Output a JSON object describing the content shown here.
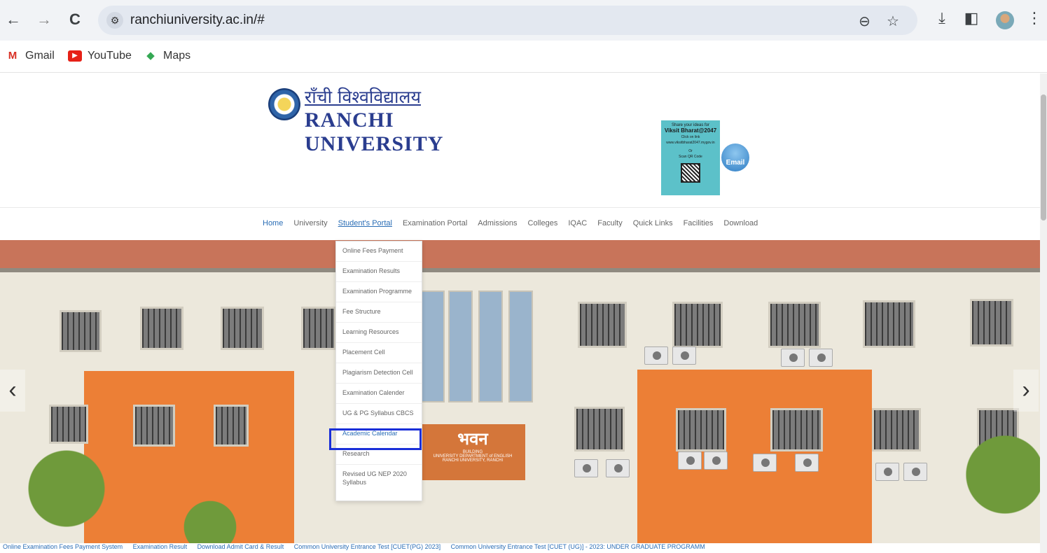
{
  "browser": {
    "url": "ranchiuniversity.ac.in/#",
    "back_icon": "←",
    "forward_icon": "→",
    "reload_icon": "C",
    "site_info_icon": "⚙",
    "zoom_icon": "⊖",
    "star_icon": "☆",
    "download_icon": "⤓",
    "sidepanel_icon": "◧",
    "menu_icon": "⋮"
  },
  "bookmarks": [
    {
      "label": "Gmail",
      "icon": "M"
    },
    {
      "label": "YouTube",
      "icon": "▶"
    },
    {
      "label": "Maps",
      "icon": "◆"
    }
  ],
  "header": {
    "hindi_name": "राँची विश्वविद्यालय",
    "english_name": "RANCHI UNIVERSITY",
    "viksit": {
      "line1": "Share your ideas for",
      "line2": "Viksit Bharat@2047",
      "line3": "Click on link",
      "line4": "www.viksitbharat2047.mygov.in",
      "line5": "Or",
      "line6": "Scan QR Code"
    },
    "email_label": "Email"
  },
  "nav": {
    "items": [
      "Home",
      "University",
      "Student's Portal",
      "Examination Portal",
      "Admissions",
      "Colleges",
      "IQAC",
      "Faculty",
      "Quick Links",
      "Facilities",
      "Download"
    ]
  },
  "dropdown": {
    "items": [
      "Online Fees Payment",
      "Examination Results",
      "Examination Programme",
      "Fee Structure",
      "Learning Resources",
      "Placement Cell",
      "Plagiarism Detection Cell",
      "Examination Calender",
      "UG & PG Syllabus CBCS",
      "Academic Calendar",
      "Research",
      "Revised UG NEP 2020 Syllabus"
    ]
  },
  "hero": {
    "sign_hindi": "भवन",
    "sign_line1": "BUILDING",
    "sign_line2": "UNIVERSITY DEPARTMENT of ENGLISH",
    "sign_line3": "RANCHI UNIVERSITY, RANCHI",
    "prev_icon": "‹",
    "next_icon": "›"
  },
  "ticker": [
    "Online Examination Fees Payment System",
    "Examination Result",
    "Download Admit Card & Result",
    "Common University Entrance Test [CUET(PG) 2023]",
    "Common University Entrance Test [CUET (UG)] - 2023: UNDER GRADUATE PROGRAMM"
  ]
}
